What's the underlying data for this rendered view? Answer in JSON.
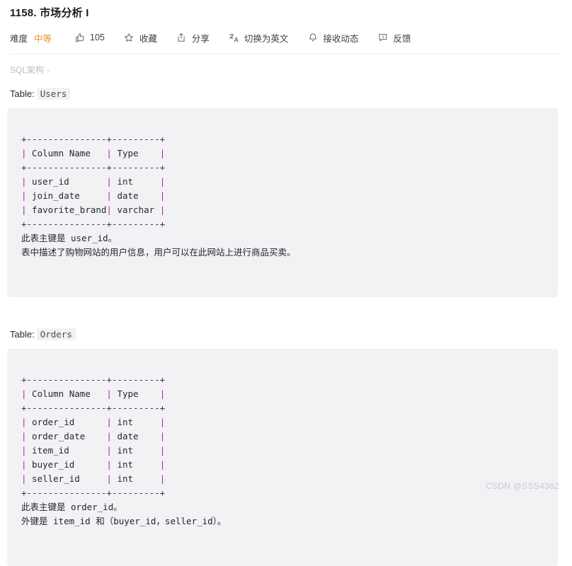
{
  "page": {
    "title": "1158. 市场分析 I",
    "watermark": "CSDN @SSS4362"
  },
  "toolbar": {
    "difficulty_label": "难度",
    "difficulty_value": "中等",
    "difficulty_color": "#f0932b",
    "like_count": "105",
    "favorite_label": "收藏",
    "share_label": "分享",
    "translate_label": "切换为英文",
    "subscribe_label": "接收动态",
    "feedback_label": "反馈",
    "icons": {
      "like": "thumbs-up-icon",
      "favorite": "star-icon",
      "share": "share-icon",
      "translate": "translate-icon",
      "subscribe": "bell-icon",
      "feedback": "comment-icon"
    }
  },
  "breadcrumb": {
    "label": "SQL架构",
    "chevron": "›"
  },
  "tables": [
    {
      "caption_prefix": "Table:",
      "caption_name": "Users",
      "ascii": {
        "rule_top": "+---------------+---------+",
        "header_pipe_1": "|",
        "header_col": " Column Name   ",
        "header_pipe_2": "|",
        "header_type": " Type    ",
        "header_pipe_3": "|",
        "rule_mid": "+---------------+---------+",
        "rows": [
          {
            "col": " user_id       ",
            "type": " int     "
          },
          {
            "col": " join_date     ",
            "type": " date    "
          },
          {
            "col": " favorite_brand",
            "type": " varchar "
          }
        ],
        "rule_bottom": "+---------------+---------+"
      },
      "notes": [
        "此表主键是 user_id。",
        "表中描述了购物网站的用户信息，用户可以在此网站上进行商品买卖。"
      ]
    },
    {
      "caption_prefix": "Table:",
      "caption_name": "Orders",
      "ascii": {
        "rule_top": "+---------------+---------+",
        "header_pipe_1": "|",
        "header_col": " Column Name   ",
        "header_pipe_2": "|",
        "header_type": " Type    ",
        "header_pipe_3": "|",
        "rule_mid": "+---------------+---------+",
        "rows": [
          {
            "col": " order_id      ",
            "type": " int     "
          },
          {
            "col": " order_date    ",
            "type": " date    "
          },
          {
            "col": " item_id       ",
            "type": " int     "
          },
          {
            "col": " buyer_id      ",
            "type": " int     "
          },
          {
            "col": " seller_id     ",
            "type": " int     "
          }
        ],
        "rule_bottom": "+---------------+---------+"
      },
      "notes": [
        "此表主键是 order_id。",
        "外键是 item_id 和（buyer_id，seller_id）。"
      ]
    }
  ]
}
